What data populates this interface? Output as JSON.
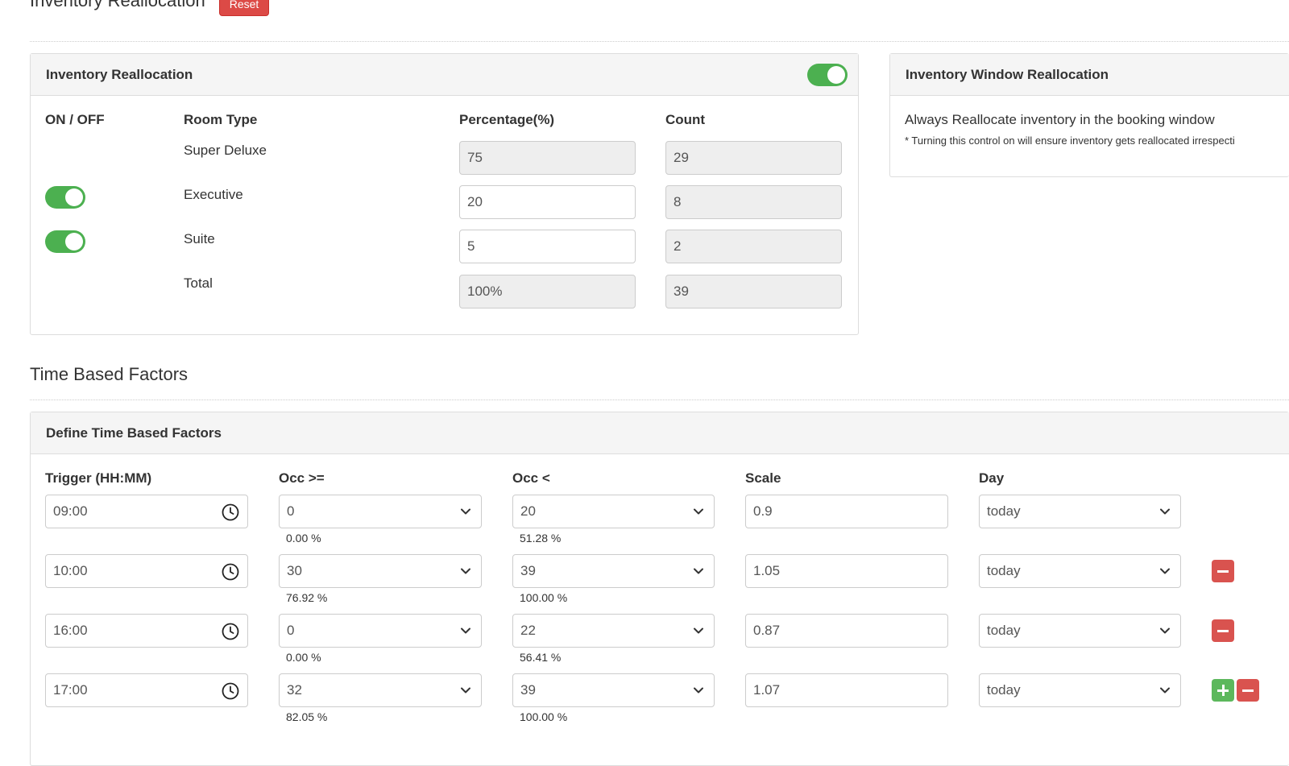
{
  "page": {
    "title": "Inventory Reallocation",
    "reset_label": "Reset",
    "section_title": "Time Based Factors"
  },
  "inventory_panel": {
    "title": "Inventory Reallocation",
    "master_toggle_on": true,
    "headers": {
      "on_off": "ON / OFF",
      "room_type": "Room Type",
      "percentage": "Percentage(%)",
      "count": "Count"
    },
    "rows": [
      {
        "room_type": "Super Deluxe",
        "has_toggle": false,
        "percentage": "75",
        "count": "29",
        "percentage_readonly": true
      },
      {
        "room_type": "Executive",
        "has_toggle": true,
        "percentage": "20",
        "count": "8",
        "percentage_readonly": false
      },
      {
        "room_type": "Suite",
        "has_toggle": true,
        "percentage": "5",
        "count": "2",
        "percentage_readonly": false
      },
      {
        "room_type": "Total",
        "has_toggle": false,
        "percentage": "100%",
        "count": "39",
        "percentage_readonly": true
      }
    ]
  },
  "window_panel": {
    "title": "Inventory Window Reallocation",
    "description": "Always Reallocate inventory in the booking window",
    "note": "* Turning this control on will ensure inventory gets reallocated irrespecti"
  },
  "time_factors": {
    "panel_title": "Define Time Based Factors",
    "headers": {
      "trigger": "Trigger (HH:MM)",
      "occ_gte": "Occ >=",
      "occ_lt": "Occ <",
      "scale": "Scale",
      "day": "Day"
    },
    "rows": [
      {
        "trigger": "09:00",
        "occ_gte": "0",
        "occ_gte_pct": "0.00 %",
        "occ_lt": "20",
        "occ_lt_pct": "51.28 %",
        "scale": "0.9",
        "day": "today"
      },
      {
        "trigger": "10:00",
        "occ_gte": "30",
        "occ_gte_pct": "76.92 %",
        "occ_lt": "39",
        "occ_lt_pct": "100.00 %",
        "scale": "1.05",
        "day": "today"
      },
      {
        "trigger": "16:00",
        "occ_gte": "0",
        "occ_gte_pct": "0.00 %",
        "occ_lt": "22",
        "occ_lt_pct": "56.41 %",
        "scale": "0.87",
        "day": "today"
      },
      {
        "trigger": "17:00",
        "occ_gte": "32",
        "occ_gte_pct": "82.05 %",
        "occ_lt": "39",
        "occ_lt_pct": "100.00 %",
        "scale": "1.07",
        "day": "today"
      }
    ]
  },
  "colors": {
    "toggle_on": "#4cb050",
    "danger": "#d9534f",
    "success": "#5cb85c"
  }
}
